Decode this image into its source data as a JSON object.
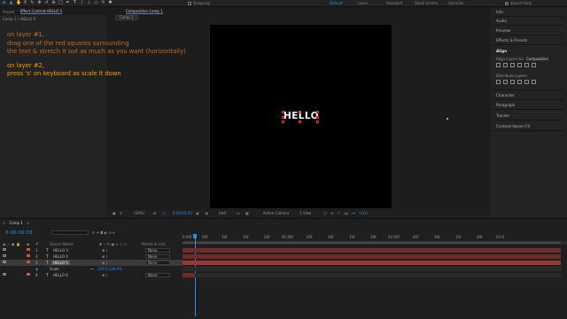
{
  "toolbar": {
    "snapping_label": "Snapping",
    "workspaces": [
      "Default",
      "Learn",
      "Standard",
      "Small Screen",
      "Libraries"
    ],
    "active_workspace": "Default",
    "search_label": "Search Help",
    "accent": "#2d8ceb"
  },
  "left_panel": {
    "tabs": [
      "Project",
      "Effect Controls HELLO 5"
    ],
    "subtitle": "Comp 1 • HELLO 5"
  },
  "instructions": {
    "line1": "on layer #1,",
    "line2": "drag one of the red squares surrounding",
    "line3": "the text & stretch it out as much as you want (horizontally)",
    "line4": "on layer #2,",
    "line5": "press 's' on keyboard as scale it down"
  },
  "composition": {
    "tab": "Composition Comp 1",
    "breadcrumb": "Comp 1",
    "text_layer": "HELLO",
    "viewer": {
      "zoom": "(50%)",
      "time": "0:00:00:03",
      "resolution": "Half",
      "camera": "Active Camera",
      "views": "1 View",
      "exposure": "+0.0"
    }
  },
  "right_panel": {
    "items": [
      "Info",
      "Audio",
      "Preview",
      "Effects & Presets",
      "Align",
      "Character",
      "Paragraph",
      "Tracker",
      "Content-Aware Fill"
    ],
    "align_layers_to_label": "Align Layers to:",
    "align_layers_to_value": "Composition",
    "distribute_label": "Distribute Layers:"
  },
  "timeline": {
    "tab": "Comp 1",
    "timecode": "0:00:00:03",
    "columns": {
      "num": "#",
      "source_name": "Source Name",
      "parent": "Parent & Link"
    },
    "layers": [
      {
        "num": "1",
        "name": "HELLO 3",
        "parent": "None",
        "color": "#c1584c",
        "selected": false
      },
      {
        "num": "2",
        "name": "HELLO 4",
        "parent": "None",
        "color": "#c1584c",
        "selected": false
      },
      {
        "num": "3",
        "name": "HELLO 5",
        "parent": "None",
        "color": "#c1584c",
        "selected": true
      },
      {
        "num": "",
        "name": "Scale",
        "parent": "",
        "color": "#000000",
        "selected": false,
        "property": true,
        "value": "139.0,138.0%"
      },
      {
        "num": "4",
        "name": "HELLO 6",
        "parent": "None",
        "color": "#c1584c",
        "selected": false
      }
    ],
    "ruler_labels": [
      "0:00f",
      "05f",
      "10f",
      "15f",
      "20f",
      "01:00f",
      "05f",
      "10f",
      "15f",
      "20f",
      "02:00f",
      "05f",
      "10f",
      "15f",
      "20f",
      "03:0"
    ]
  }
}
